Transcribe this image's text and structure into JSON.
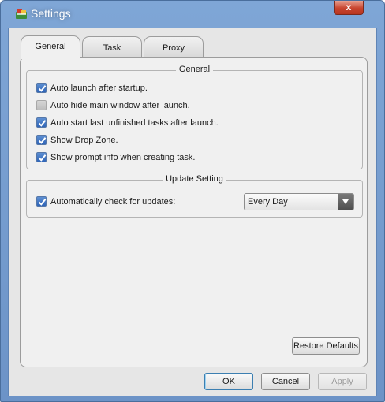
{
  "window": {
    "title": "Settings",
    "app_icon": "app-logo-icon",
    "close_label": "x",
    "colors": {
      "frame": "#7fa6d6",
      "close": "#c8452f",
      "checkbox": "#3b6fc0"
    }
  },
  "tabs": [
    {
      "label": "General",
      "active": true
    },
    {
      "label": "Task",
      "active": false
    },
    {
      "label": "Proxy",
      "active": false
    }
  ],
  "general_group": {
    "title": "General",
    "options": [
      {
        "label": "Auto launch after startup.",
        "checked": true
      },
      {
        "label": "Auto hide main window after launch.",
        "checked": false
      },
      {
        "label": "Auto start last unfinished tasks after launch.",
        "checked": true
      },
      {
        "label": "Show Drop Zone.",
        "checked": true
      },
      {
        "label": "Show prompt info when creating task.",
        "checked": true
      }
    ]
  },
  "update_group": {
    "title": "Update Setting",
    "auto_check": {
      "label": "Automatically check for updates:",
      "checked": true
    },
    "frequency": {
      "value": "Every Day"
    }
  },
  "buttons": {
    "restore_defaults": "Restore Defaults",
    "ok": "OK",
    "cancel": "Cancel",
    "apply": "Apply"
  }
}
